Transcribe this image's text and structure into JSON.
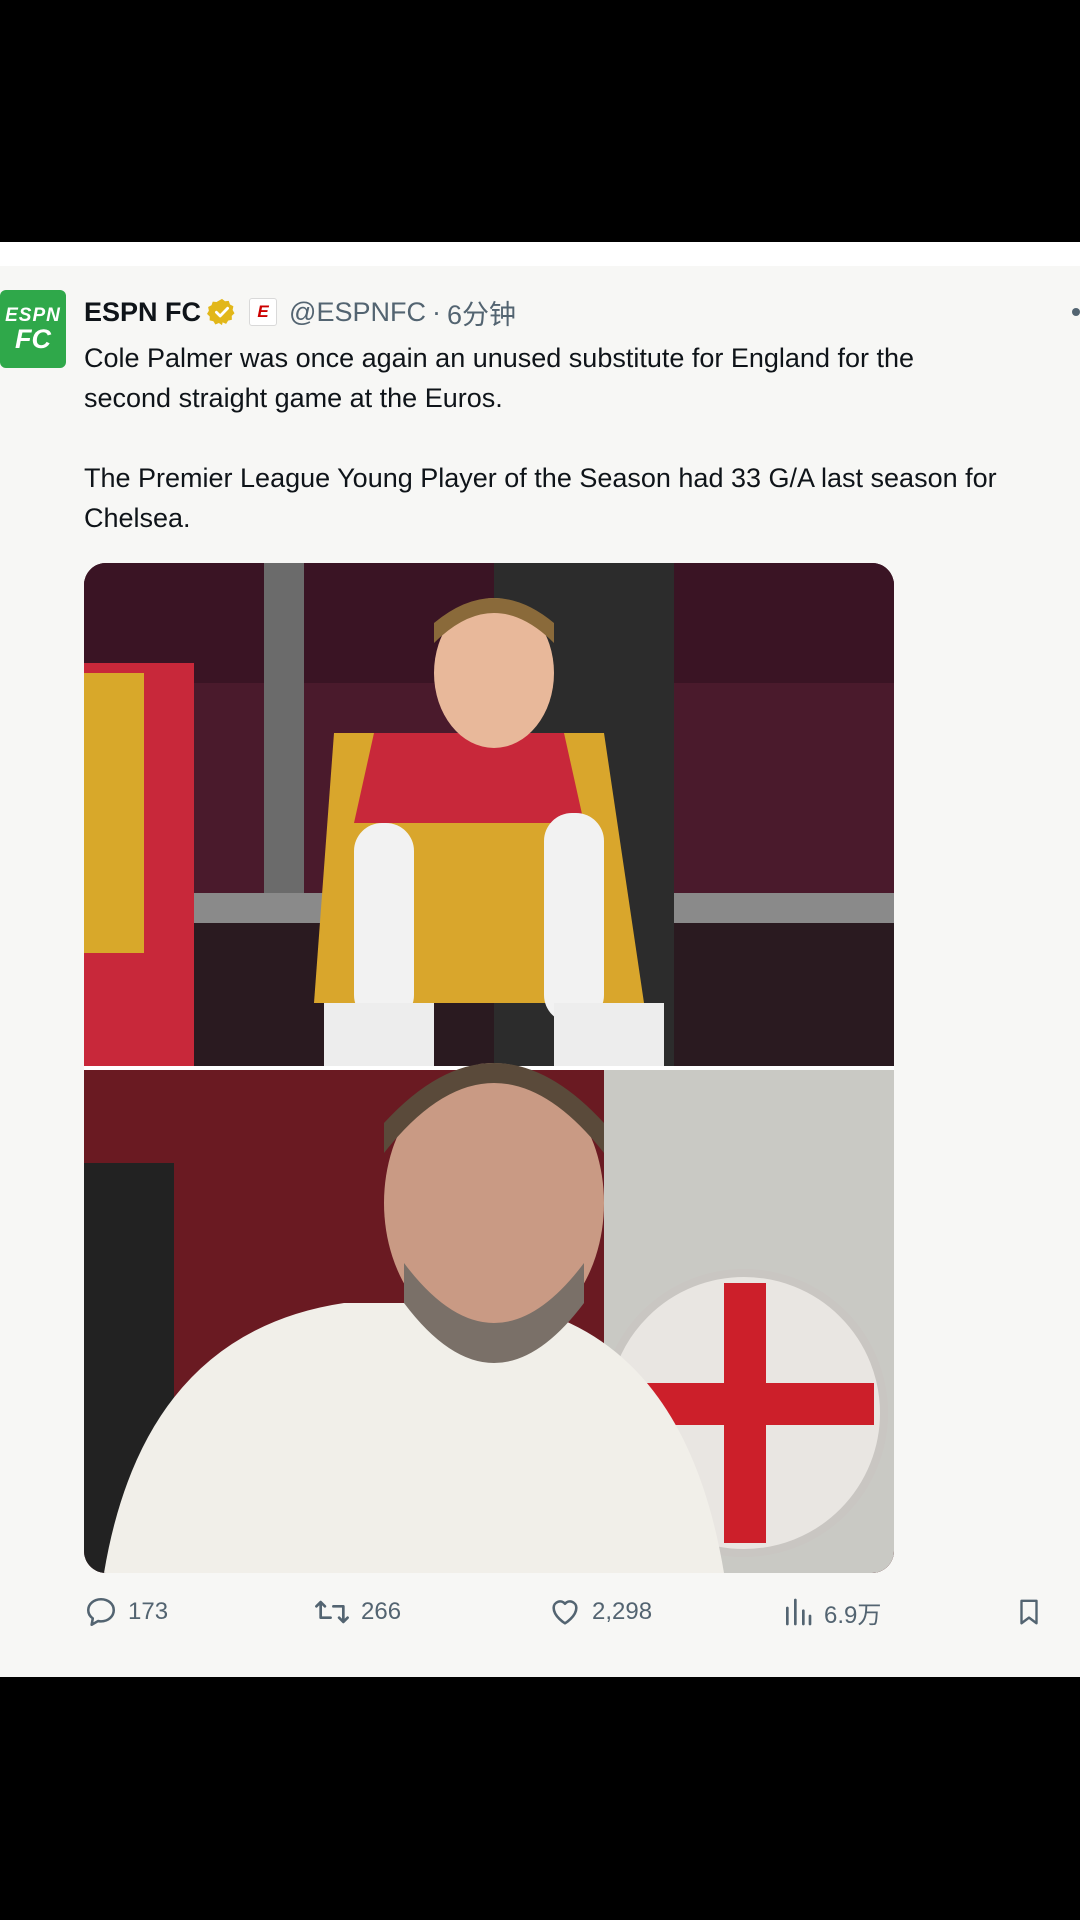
{
  "tweet": {
    "author_name": "ESPN FC",
    "avatar_text_line1": "ESPN",
    "avatar_text_line2": "FC",
    "affiliate_badge_letter": "E",
    "handle": "@ESPNFC",
    "separator": "·",
    "time": "6分钟",
    "text_line1": "Cole Palmer was once again an unused substitute for England for the",
    "text_line2": "second straight game at the Euros.",
    "text_line3": "The Premier League Young Player of the Season had 33 G/A last season for",
    "text_line4": "Chelsea.",
    "media_description": "Two stacked photos: Cole Palmer on the bench in a yellow bib, and Gareth Southgate in a white polo beside an England crest"
  },
  "actions": {
    "replies": "173",
    "reposts": "266",
    "likes": "2,298",
    "views": "6.9万"
  },
  "colors": {
    "background": "#000000",
    "card": "#f7f7f5",
    "text_primary": "#0f1419",
    "text_secondary": "#536471",
    "verified_gold": "#e2b719",
    "avatar_green": "#2fa84a",
    "espn_red": "#cc0000"
  },
  "icons": [
    "verified-icon",
    "reply-icon",
    "repost-icon",
    "like-icon",
    "views-icon",
    "bookmark-icon",
    "more-icon"
  ]
}
